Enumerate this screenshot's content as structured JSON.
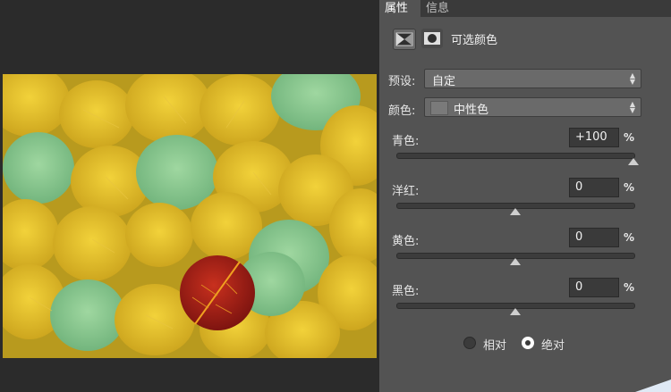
{
  "tabs": [
    "属性",
    "信息"
  ],
  "header": {
    "title": "可选颜色",
    "icons": [
      "adjustment-layer-icon",
      "mask-icon"
    ]
  },
  "preset": {
    "label": "预设:",
    "value": "自定"
  },
  "color": {
    "label": "颜色:",
    "value": "中性色"
  },
  "sliders": [
    {
      "label": "青色:",
      "value": "+100",
      "unit": "%",
      "level": 1.0
    },
    {
      "label": "洋红:",
      "value": "0",
      "unit": "%",
      "level": 0.5
    },
    {
      "label": "黄色:",
      "value": "0",
      "unit": "%",
      "level": 0.5
    },
    {
      "label": "黑色:",
      "value": "0",
      "unit": "%",
      "level": 0.5
    }
  ],
  "method": {
    "options": [
      "相对",
      "绝对"
    ],
    "selected": "绝对"
  },
  "colors": {
    "panel": "#535353",
    "workspace": "#2b2b2b",
    "field": "#3a3a3a"
  }
}
